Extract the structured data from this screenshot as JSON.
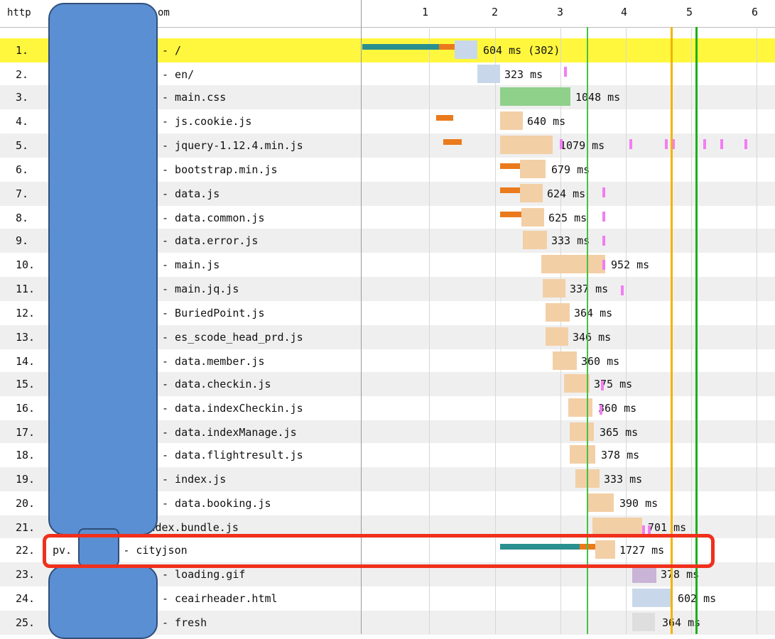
{
  "header": {
    "url_prefix": "http",
    "url_suffix": "om",
    "ticks": [
      "1",
      "2",
      "3",
      "4",
      "5",
      "6"
    ]
  },
  "colors": {
    "highlight_row": "#fff73e",
    "dns": "#2a8f8f",
    "connect": "#ea7a1c",
    "wait": "#f3cfa6",
    "receive_html": "#c8d8ea",
    "receive_css": "#8fd08b",
    "receive_img": "#c9b3d6",
    "receive_other": "#dedede",
    "js_exec": "#f27df2",
    "start_render": "#44c144",
    "dom_content": "#f2b400",
    "onload": "#1ab01a",
    "red_outline": "#f0301d",
    "redaction": "#5b8fd3"
  },
  "rows": [
    {
      "num": "1.",
      "name": "- /",
      "label": "604 ms (302)"
    },
    {
      "num": "2.",
      "name": "- en/",
      "label": "323 ms"
    },
    {
      "num": "3.",
      "name": "- main.css",
      "label": "1048 ms"
    },
    {
      "num": "4.",
      "name": "- js.cookie.js",
      "label": "640 ms"
    },
    {
      "num": "5.",
      "name": "- jquery-1.12.4.min.js",
      "label": "1079 ms"
    },
    {
      "num": "6.",
      "name": "- bootstrap.min.js",
      "label": "679 ms"
    },
    {
      "num": "7.",
      "name": "- data.js",
      "label": "624 ms"
    },
    {
      "num": "8.",
      "name": "- data.common.js",
      "label": "625 ms"
    },
    {
      "num": "9.",
      "name": "- data.error.js",
      "label": "333 ms"
    },
    {
      "num": "10.",
      "name": "- main.js",
      "label": "952 ms"
    },
    {
      "num": "11.",
      "name": "- main.jq.js",
      "label": "337 ms"
    },
    {
      "num": "12.",
      "name": "- BuriedPoint.js",
      "label": "364 ms"
    },
    {
      "num": "13.",
      "name": "- es_scode_head_prd.js",
      "label": "346 ms"
    },
    {
      "num": "14.",
      "name": "- data.member.js",
      "label": "360 ms"
    },
    {
      "num": "15.",
      "name": "- data.checkin.js",
      "label": "375 ms"
    },
    {
      "num": "16.",
      "name": "- data.indexCheckin.js",
      "label": "360 ms"
    },
    {
      "num": "17.",
      "name": "- data.indexManage.js",
      "label": "365 ms"
    },
    {
      "num": "18.",
      "name": "- data.flightresult.js",
      "label": "378 ms"
    },
    {
      "num": "19.",
      "name": "- index.js",
      "label": "333 ms"
    },
    {
      "num": "20.",
      "name": "- data.booking.js",
      "label": "390 ms"
    },
    {
      "num": "21.",
      "name": "dx.    .com - index.bundle.js",
      "label": "701 ms"
    },
    {
      "num": "22.",
      "name": "pv.    com - cityjson",
      "label": "1727 ms"
    },
    {
      "num": "23.",
      "name": "- loading.gif",
      "label": "378 ms"
    },
    {
      "num": "24.",
      "name": "- ceairheader.html",
      "label": "602 ms"
    },
    {
      "num": "25.",
      "name": "- fresh",
      "label": "364 ms"
    }
  ]
}
